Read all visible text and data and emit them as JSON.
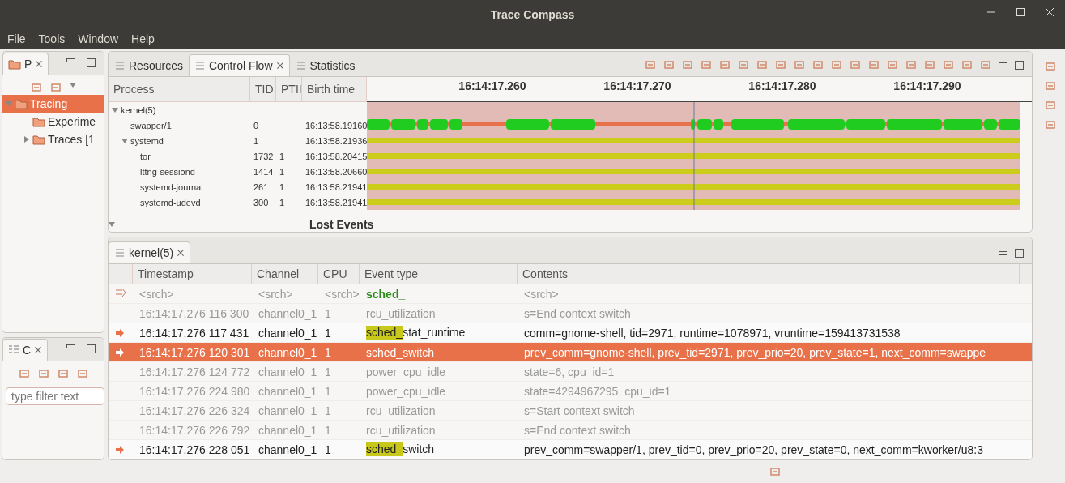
{
  "window": {
    "title": "Trace Compass"
  },
  "menu": [
    "File",
    "Tools",
    "Window",
    "Help"
  ],
  "left_panels": [
    {
      "tab": "P",
      "kind": "tree",
      "items": [
        {
          "label": "Tracing",
          "selected": true,
          "expanded": true,
          "children": [
            {
              "label": "Experime",
              "selected": false
            },
            {
              "label": "Traces [1",
              "selected": false,
              "expanded": false
            }
          ]
        }
      ]
    },
    {
      "tab": "C",
      "kind": "filter",
      "placeholder": "type filter text"
    }
  ],
  "top_view": {
    "tabs": [
      {
        "label": "Resources",
        "selected": false
      },
      {
        "label": "Control Flow",
        "selected": true
      },
      {
        "label": "Statistics",
        "selected": false
      }
    ],
    "columns": [
      "Process",
      "TID",
      "PTII",
      "Birth time"
    ],
    "time_ticks": [
      "16:14:17.260",
      "16:14:17.270",
      "16:14:17.280",
      "16:14:17.290"
    ],
    "processes": [
      {
        "name": "kernel(5)",
        "expanded": true,
        "children": [
          {
            "name": "swapper/1",
            "tid": "0",
            "birth": "16:13:58.19160",
            "kind": "cpu"
          },
          {
            "name": "systemd",
            "tid": "1",
            "birth": "16:13:58.21936",
            "kind": "blocked",
            "expanded": true,
            "children": [
              {
                "name": "tor",
                "tid": "1732",
                "ptid": "1",
                "birth": "16:13:58.20415",
                "kind": "blocked"
              },
              {
                "name": "lttng-sessiond",
                "tid": "1414",
                "ptid": "1",
                "birth": "16:13:58.20660",
                "kind": "blocked"
              },
              {
                "name": "systemd-journal",
                "tid": "261",
                "ptid": "1",
                "birth": "16:13:58.21941",
                "kind": "blocked"
              },
              {
                "name": "systemd-udevd",
                "tid": "300",
                "ptid": "1",
                "birth": "16:13:58.21941",
                "kind": "blocked"
              }
            ]
          }
        ]
      }
    ],
    "footer_label": "Lost Events"
  },
  "events_view": {
    "tab": "kernel(5)",
    "columns": [
      "Timestamp",
      "Channel",
      "CPU",
      "Event type",
      "Contents"
    ],
    "search": [
      "<srch>",
      "<srch>",
      "<srch>",
      "sched_",
      "<srch>"
    ],
    "rows": [
      {
        "timestamp": "16:14:17.276 116 300",
        "channel": "channel0_1",
        "cpu": "1",
        "event_type": "rcu_utilization",
        "contents": "s=End context switch",
        "matched": false,
        "selected": false
      },
      {
        "timestamp": "16:14:17.276 117 431",
        "channel": "channel0_1",
        "cpu": "1",
        "event_highlight": "sched_",
        "event_type": "stat_runtime",
        "contents": "comm=gnome-shell, tid=2971, runtime=1078971, vruntime=159413731538",
        "matched": true,
        "selected": false
      },
      {
        "timestamp": "16:14:17.276 120 301",
        "channel": "channel0_1",
        "cpu": "1",
        "event_type": "sched_switch",
        "contents": "prev_comm=gnome-shell, prev_tid=2971, prev_prio=20, prev_state=1, next_comm=swappe",
        "matched": true,
        "selected": true
      },
      {
        "timestamp": "16:14:17.276 124 772",
        "channel": "channel0_1",
        "cpu": "1",
        "event_type": "power_cpu_idle",
        "contents": "state=6, cpu_id=1",
        "matched": false,
        "selected": false
      },
      {
        "timestamp": "16:14:17.276 224 980",
        "channel": "channel0_1",
        "cpu": "1",
        "event_type": "power_cpu_idle",
        "contents": "state=4294967295, cpu_id=1",
        "matched": false,
        "selected": false
      },
      {
        "timestamp": "16:14:17.276 226 324",
        "channel": "channel0_1",
        "cpu": "1",
        "event_type": "rcu_utilization",
        "contents": "s=Start context switch",
        "matched": false,
        "selected": false
      },
      {
        "timestamp": "16:14:17.276 226 792",
        "channel": "channel0_1",
        "cpu": "1",
        "event_type": "rcu_utilization",
        "contents": "s=End context switch",
        "matched": false,
        "selected": false
      },
      {
        "timestamp": "16:14:17.276 228 051",
        "channel": "channel0_1",
        "cpu": "1",
        "event_highlight": "sched_",
        "event_type": "switch",
        "contents": "prev_comm=swapper/1, prev_tid=0, prev_prio=20, prev_state=0, next_comm=kworker/u8:3",
        "matched": true,
        "selected": false
      }
    ]
  }
}
